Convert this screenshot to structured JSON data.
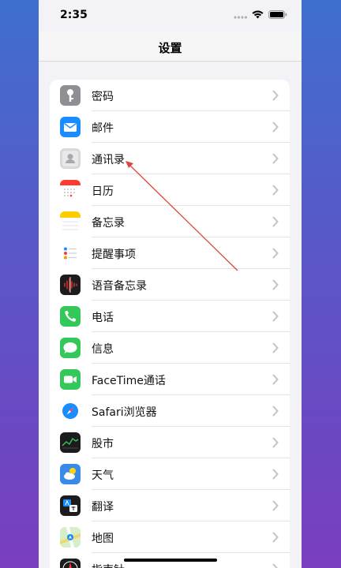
{
  "status": {
    "time": "2:35"
  },
  "nav": {
    "title": "设置"
  },
  "items": [
    {
      "label": "密码",
      "icon": "key-icon",
      "color": "#8e8e93"
    },
    {
      "label": "邮件",
      "icon": "mail-icon",
      "color": "#1a8cff"
    },
    {
      "label": "通讯录",
      "icon": "contacts-icon",
      "color": "#c8c8cc"
    },
    {
      "label": "日历",
      "icon": "calendar-icon",
      "color": "#ff3b30"
    },
    {
      "label": "备忘录",
      "icon": "notes-icon",
      "color": "#ffcc00"
    },
    {
      "label": "提醒事项",
      "icon": "reminders-icon",
      "color": "#ffffff"
    },
    {
      "label": "语音备忘录",
      "icon": "voice-memos-icon",
      "color": "#1c1c1e"
    },
    {
      "label": "电话",
      "icon": "phone-icon",
      "color": "#34c759"
    },
    {
      "label": "信息",
      "icon": "messages-icon",
      "color": "#34c759"
    },
    {
      "label": "FaceTime通话",
      "icon": "facetime-icon",
      "color": "#34c759"
    },
    {
      "label": "Safari浏览器",
      "icon": "safari-icon",
      "color": "#1a8cff"
    },
    {
      "label": "股市",
      "icon": "stocks-icon",
      "color": "#1c1c1e"
    },
    {
      "label": "天气",
      "icon": "weather-icon",
      "color": "#3a8be8"
    },
    {
      "label": "翻译",
      "icon": "translate-icon",
      "color": "#1c1c1e"
    },
    {
      "label": "地图",
      "icon": "maps-icon",
      "color": "#7fd36b"
    },
    {
      "label": "指南针",
      "icon": "compass-icon",
      "color": "#1c1c1e"
    }
  ]
}
